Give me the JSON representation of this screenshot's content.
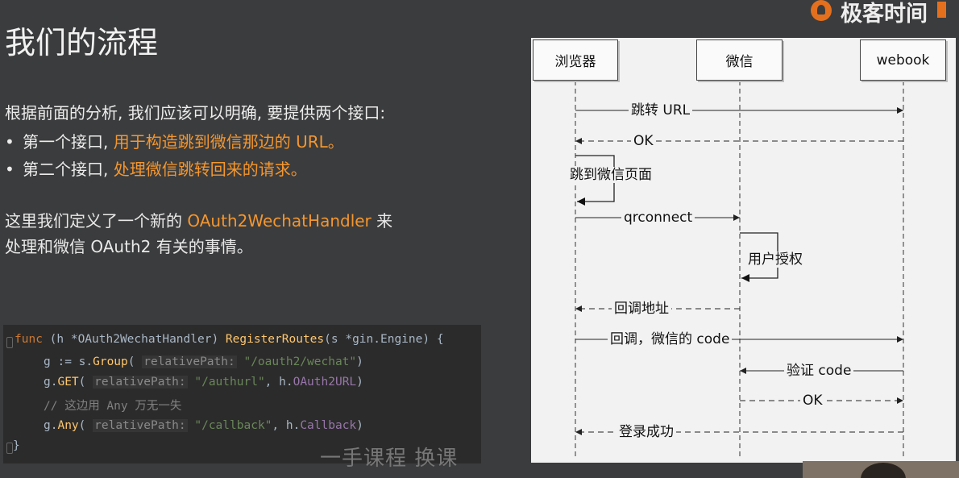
{
  "brand": {
    "name": "极客时间"
  },
  "slide": {
    "title": "我们的流程",
    "intro": "根据前面的分析, 我们应该可以明确, 要提供两个接口:",
    "bullets": [
      {
        "prefix": "第一个接口, ",
        "highlight": "用于构造跳到微信那边的 URL。"
      },
      {
        "prefix": "第二个接口, ",
        "highlight": "处理微信跳转回来的请求。"
      }
    ],
    "para": {
      "before": "这里我们定义了一个新的 ",
      "highlight": "OAuth2WechatHandler",
      "after": " 来",
      "line2": "处理和微信 OAuth2 有关的事情。"
    },
    "code": {
      "l1": {
        "kw": "func",
        "a": " (h *",
        "type": "OAuth2WechatHandler",
        "b": ") ",
        "fn": "RegisterRoutes",
        "c": "(s *",
        "pkg": "gin.Engine",
        "d": ") {"
      },
      "l2": {
        "a": "g := s.",
        "fn": "Group",
        "b": "( ",
        "hint": "relativePath:",
        "str": " \"/oauth2/wechat\"",
        "c": ")"
      },
      "l3": {
        "a": "g.",
        "fn": "GET",
        "b": "( ",
        "hint": "relativePath:",
        "str": " \"/authurl\"",
        "c": ", h.",
        "fn2": "OAuth2URL",
        "d": ")"
      },
      "l4": {
        "cm": "// 这边用 Any 万无一失"
      },
      "l5": {
        "a": "g.",
        "fn": "Any",
        "b": "( ",
        "hint": "relativePath:",
        "str": " \"/callback\"",
        "c": ", h.",
        "fn2": "Callback",
        "d": ")"
      },
      "l6": {
        "a": "}"
      }
    },
    "watermark": "一手课程 换课"
  },
  "sequence": {
    "participants": [
      "浏览器",
      "微信",
      "webook"
    ],
    "messages": [
      "跳转 URL",
      "OK",
      "跳到微信页面",
      "qrconnect",
      "用户授权",
      "回调地址",
      "回调，微信的 code",
      "验证 code",
      "OK",
      "登录成功"
    ]
  },
  "colors": {
    "background": "#3b3c3d",
    "accent": "#f4962e",
    "diagram_bg": "#f2f2f2"
  }
}
